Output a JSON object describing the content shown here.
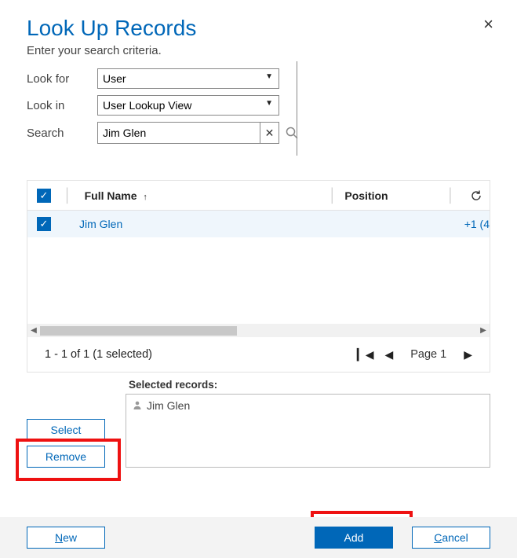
{
  "dialog": {
    "title": "Look Up Records",
    "subtitle": "Enter your search criteria.",
    "close_label": "×"
  },
  "form": {
    "look_for_label": "Look for",
    "look_for_value": "User",
    "look_in_label": "Look in",
    "look_in_value": "User Lookup View",
    "search_label": "Search",
    "search_value": "Jim Glen",
    "search_clear": "✕"
  },
  "grid": {
    "columns": {
      "full_name": "Full Name",
      "position": "Position"
    },
    "sort_column": "full_name",
    "sort_dir": "asc",
    "header_checked": true,
    "rows": [
      {
        "checked": true,
        "full_name": "Jim Glen",
        "position": "",
        "main_phone": "+1 (4"
      }
    ],
    "footer": {
      "count_text": "1 - 1 of 1 (1 selected)",
      "page_label": "Page 1"
    }
  },
  "selected": {
    "label": "Selected records:",
    "items": [
      {
        "name": "Jim Glen"
      }
    ],
    "select_btn": "Select",
    "remove_btn": "Remove"
  },
  "buttons": {
    "new_label": "New",
    "add_label": "Add",
    "cancel_label": "Cancel"
  }
}
